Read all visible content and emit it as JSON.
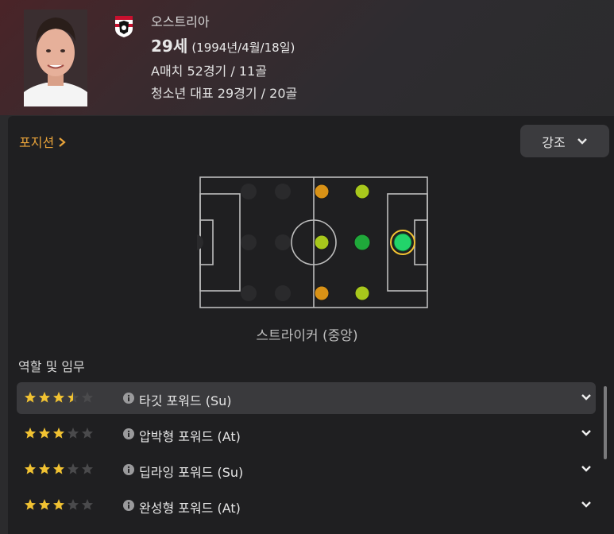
{
  "player": {
    "country": "오스트리아",
    "age": "29세",
    "birth": "(1994년/4월/18일)",
    "caps": "A매치 52경기 / 11골",
    "youth": "청소년 대표 29경기 / 20골"
  },
  "positions": {
    "link_label": "포지션",
    "emphasis_label": "강조",
    "caption": "스트라이커 (중앙)"
  },
  "roles": {
    "title": "역할 및 임무",
    "items": [
      {
        "label": "타깃 포워드 (Su)",
        "stars": 3.5,
        "active": true
      },
      {
        "label": "압박형 포워드 (At)",
        "stars": 3,
        "active": false
      },
      {
        "label": "딥라잉 포워드 (Su)",
        "stars": 3,
        "active": false
      },
      {
        "label": "완성형 포워드 (At)",
        "stars": 3,
        "active": false
      }
    ]
  },
  "colors": {
    "accent": "#e8a33a",
    "star": "#f1c232",
    "natural": "#22d46a",
    "accomplished": "#1fa83a",
    "competent": "#a8c81c",
    "unconvincing": "#d99216"
  }
}
